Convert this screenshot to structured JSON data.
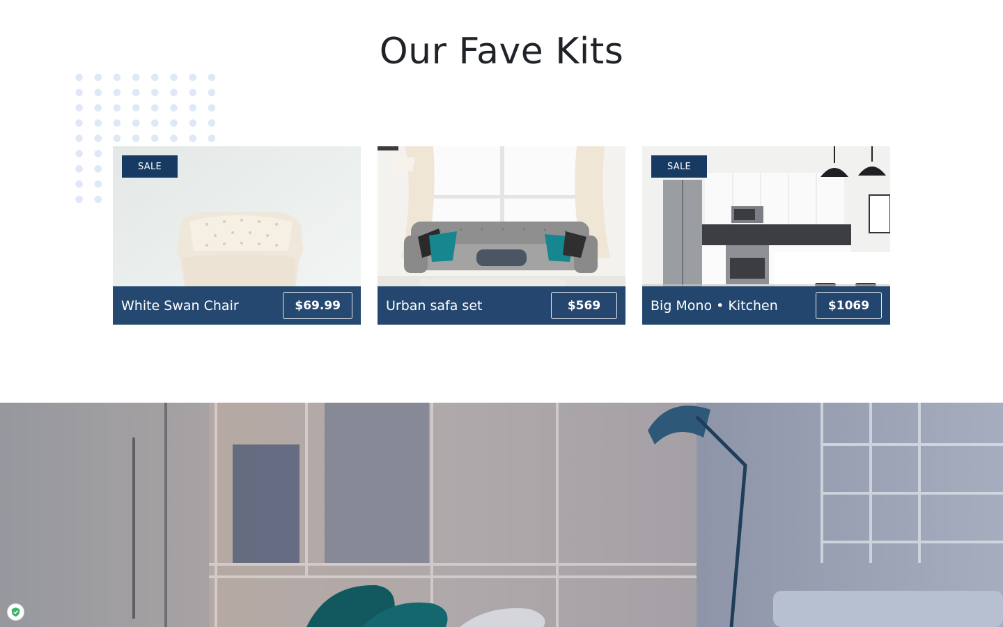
{
  "section": {
    "title": "Our Fave Kits"
  },
  "products": [
    {
      "name": "White Swan Chair",
      "price": "$69.99",
      "badge": "SALE"
    },
    {
      "name": "Urban safa set",
      "price": "$569",
      "badge": ""
    },
    {
      "name": "Big Mono • Kitchen",
      "price": "$1069",
      "badge": "SALE"
    }
  ],
  "colors": {
    "brand_navy": "#173a63",
    "footer_overlay": "#143965",
    "dot_grid": "#dfe8f6",
    "accent_teal": "#16818a"
  },
  "icons": {
    "security_badge": "shield-check-icon"
  }
}
